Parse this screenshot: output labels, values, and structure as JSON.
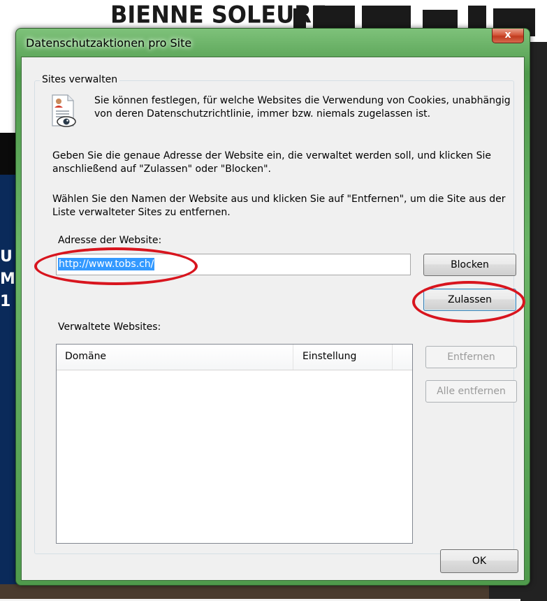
{
  "background": {
    "banner_text": "BIENNE SOLEURE",
    "side_letters": [
      "U",
      "M",
      "1"
    ]
  },
  "window": {
    "title": "Datenschutzaktionen pro Site",
    "close_glyph": "x"
  },
  "group": {
    "legend": "Sites verwalten",
    "intro": "Sie können festlegen, für welche Websites die Verwendung von Cookies, unabhängig von deren Datenschutzrichtlinie, immer bzw. niemals zugelassen ist.",
    "instruction_add": "Geben Sie die genaue Adresse der Website ein, die verwaltet werden soll, und klicken Sie anschließend auf \"Zulassen\" oder \"Blocken\".",
    "instruction_remove": "Wählen Sie den Namen der Website aus und klicken Sie auf \"Entfernen\", um die Site aus der Liste verwalteter Sites zu entfernen.",
    "address_label": "Adresse der Website:",
    "address_value": "http://www.tobs.ch/",
    "managed_label": "Verwaltete Websites:",
    "columns": [
      "Domäne",
      "Einstellung"
    ],
    "rows": []
  },
  "buttons": {
    "block": "Blocken",
    "allow": "Zulassen",
    "remove": "Entfernen",
    "remove_all": "Alle entfernen",
    "ok": "OK"
  },
  "colors": {
    "frame_green": "#4f9a4c",
    "annotation_red": "#d8151e",
    "selection_blue": "#3399ff"
  }
}
